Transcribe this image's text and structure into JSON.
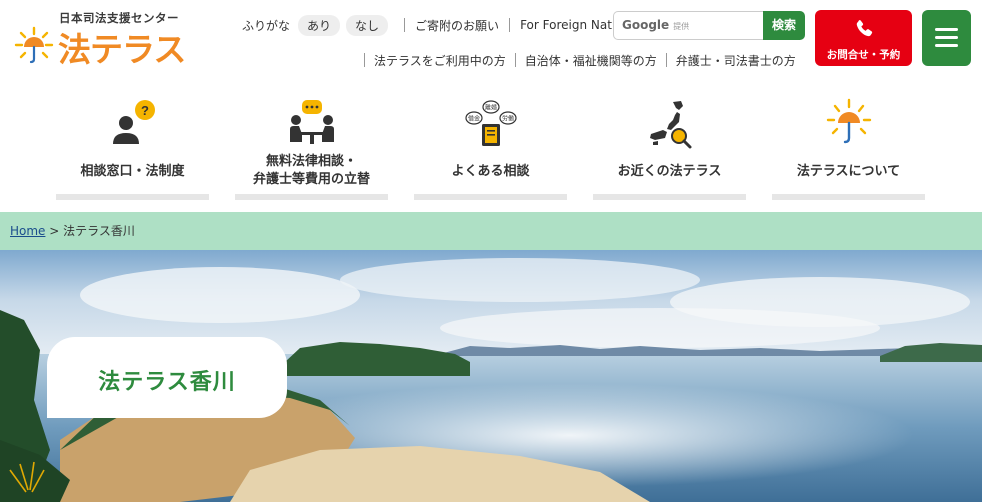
{
  "logo": {
    "subtitle": "日本司法支援センター",
    "name": "法テラス"
  },
  "utility": {
    "furigana_label": "ふりがな",
    "furigana_on": "あり",
    "furigana_off": "なし",
    "donation": "ご寄附のお願い",
    "foreign": "For Foreign Nationals",
    "links": [
      "法テラスをご利用中の方",
      "自治体・福祉機関等の方",
      "弁護士・司法書士の方"
    ]
  },
  "search": {
    "google": "Google",
    "provided": "提供",
    "button": "検索"
  },
  "contact": {
    "label": "お問合せ・予約"
  },
  "nav": [
    {
      "line1": "相談窓口・法制度",
      "line2": "",
      "icon": "consultant-icon"
    },
    {
      "line1": "無料法律相談・",
      "line2": "弁護士等費用の立替",
      "icon": "consultation-meeting-icon"
    },
    {
      "line1": "よくある相談",
      "line2": "",
      "icon": "faq-book-icon",
      "bubbles": [
        "離婚",
        "借金",
        "労働"
      ]
    },
    {
      "line1": "お近くの法テラス",
      "line2": "",
      "icon": "japan-map-search-icon"
    },
    {
      "line1": "法テラスについて",
      "line2": "",
      "icon": "sun-umbrella-icon"
    }
  ],
  "breadcrumb": {
    "home": "Home",
    "separator": ">",
    "current": "法テラス香川"
  },
  "hero": {
    "title": "法テラス香川"
  },
  "colors": {
    "green": "#2e8b3e",
    "red": "#e60012",
    "orange": "#f08a24",
    "mint": "#aee0c5"
  }
}
